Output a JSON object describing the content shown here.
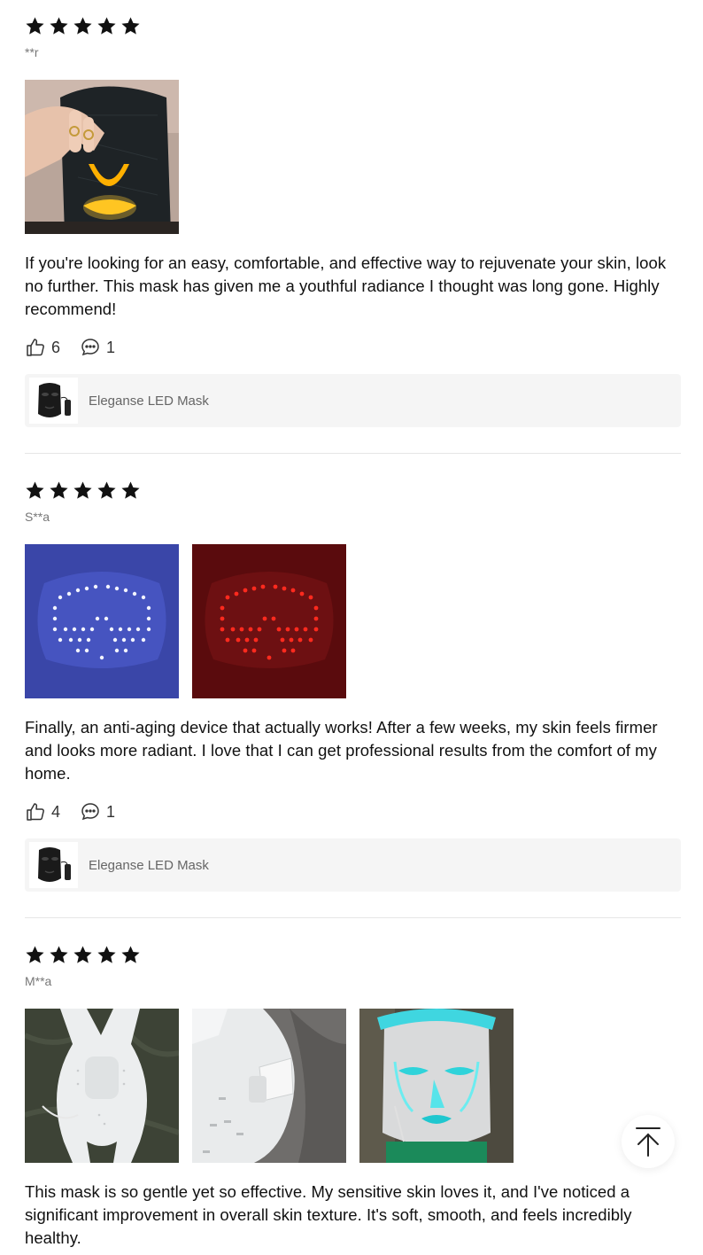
{
  "reviews": [
    {
      "rating": 5,
      "author": "**r",
      "text": "If you're looking for an easy, comfortable, and effective way to rejuvenate your skin, look no further. This mask has given me a youthful radiance I thought was long gone. Highly recommend!",
      "likes": "6",
      "comments": "1",
      "product": "Eleganse LED Mask"
    },
    {
      "rating": 5,
      "author": "S**a",
      "text": "Finally, an anti-aging device that actually works! After a few weeks, my skin feels firmer and looks more radiant. I love that I can get professional results from the comfort of my home.",
      "likes": "4",
      "comments": "1",
      "product": "Eleganse LED Mask"
    },
    {
      "rating": 5,
      "author": "M**a",
      "text": "This mask is so gentle yet so effective. My sensitive skin loves it, and I've noticed a significant improvement in overall skin texture. It's soft, smooth, and feels incredibly healthy."
    }
  ],
  "icons": {
    "star": "star-icon",
    "like": "thumbs-up-icon",
    "comment": "comment-bubble-icon",
    "back_to_top": "arrow-up-icon"
  },
  "colors": {
    "star": "#111111",
    "muted_text": "#777777",
    "card_bg": "#f5f5f5",
    "divider": "#e6e6e6"
  }
}
